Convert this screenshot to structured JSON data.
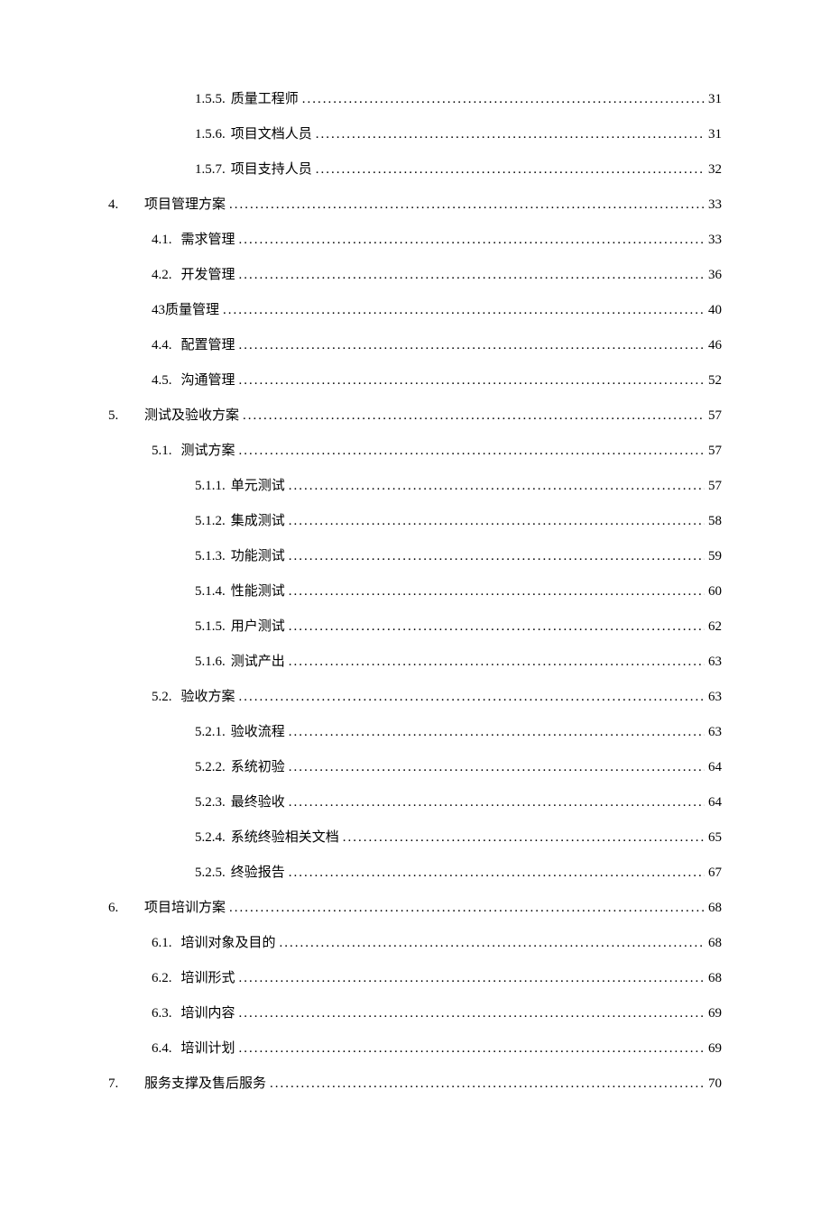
{
  "toc": [
    {
      "level": 3,
      "num": "1.5.5.",
      "title": "质量工程师",
      "page": "31"
    },
    {
      "level": 3,
      "num": "1.5.6.",
      "title": "项目文档人员",
      "page": "31"
    },
    {
      "level": 3,
      "num": "1.5.7.",
      "title": "项目支持人员",
      "page": "32"
    },
    {
      "level": 1,
      "num": "4.",
      "title": "项目管理方案",
      "page": "33"
    },
    {
      "level": 2,
      "num": "4.1.",
      "title": "需求管理",
      "page": "33"
    },
    {
      "level": 2,
      "num": "4.2.",
      "title": "开发管理",
      "page": "36"
    },
    {
      "level": 2,
      "num": "",
      "title": "43质量管理",
      "page": "40"
    },
    {
      "level": 2,
      "num": "4.4.",
      "title": "配置管理",
      "page": "46"
    },
    {
      "level": 2,
      "num": "4.5.",
      "title": "沟通管理",
      "page": "52"
    },
    {
      "level": 1,
      "num": "5.",
      "title": "测试及验收方案",
      "page": "57"
    },
    {
      "level": 2,
      "num": "5.1.",
      "title": "测试方案",
      "page": "57"
    },
    {
      "level": 3,
      "num": "5.1.1.",
      "title": "单元测试",
      "page": "57"
    },
    {
      "level": 3,
      "num": "5.1.2.",
      "title": "集成测试",
      "page": "58"
    },
    {
      "level": 3,
      "num": "5.1.3.",
      "title": "功能测试",
      "page": "59"
    },
    {
      "level": 3,
      "num": "5.1.4.",
      "title": "性能测试",
      "page": "60"
    },
    {
      "level": 3,
      "num": "5.1.5.",
      "title": "用户测试",
      "page": "62"
    },
    {
      "level": 3,
      "num": "5.1.6.",
      "title": "测试产出",
      "page": "63"
    },
    {
      "level": 2,
      "num": "5.2.",
      "title": "验收方案",
      "page": "63"
    },
    {
      "level": 3,
      "num": "5.2.1.",
      "title": "验收流程",
      "page": "63"
    },
    {
      "level": 3,
      "num": "5.2.2.",
      "title": "系统初验",
      "page": "64"
    },
    {
      "level": 3,
      "num": "5.2.3.",
      "title": "最终验收",
      "page": "64"
    },
    {
      "level": 3,
      "num": "5.2.4.",
      "title": "系统终验相关文档",
      "page": "65"
    },
    {
      "level": 3,
      "num": "5.2.5.",
      "title": "终验报告",
      "page": "67"
    },
    {
      "level": 1,
      "num": "6.",
      "title": "项目培训方案",
      "page": "68"
    },
    {
      "level": 2,
      "num": "6.1.",
      "title": "培训对象及目的",
      "page": "68"
    },
    {
      "level": 2,
      "num": "6.2.",
      "title": "培训形式",
      "page": "68"
    },
    {
      "level": 2,
      "num": "6.3.",
      "title": "培训内容",
      "page": "69"
    },
    {
      "level": 2,
      "num": "6.4.",
      "title": "培训计划",
      "page": "69"
    },
    {
      "level": 1,
      "num": "7.",
      "title": "服务支撑及售后服务",
      "page": "70"
    }
  ]
}
